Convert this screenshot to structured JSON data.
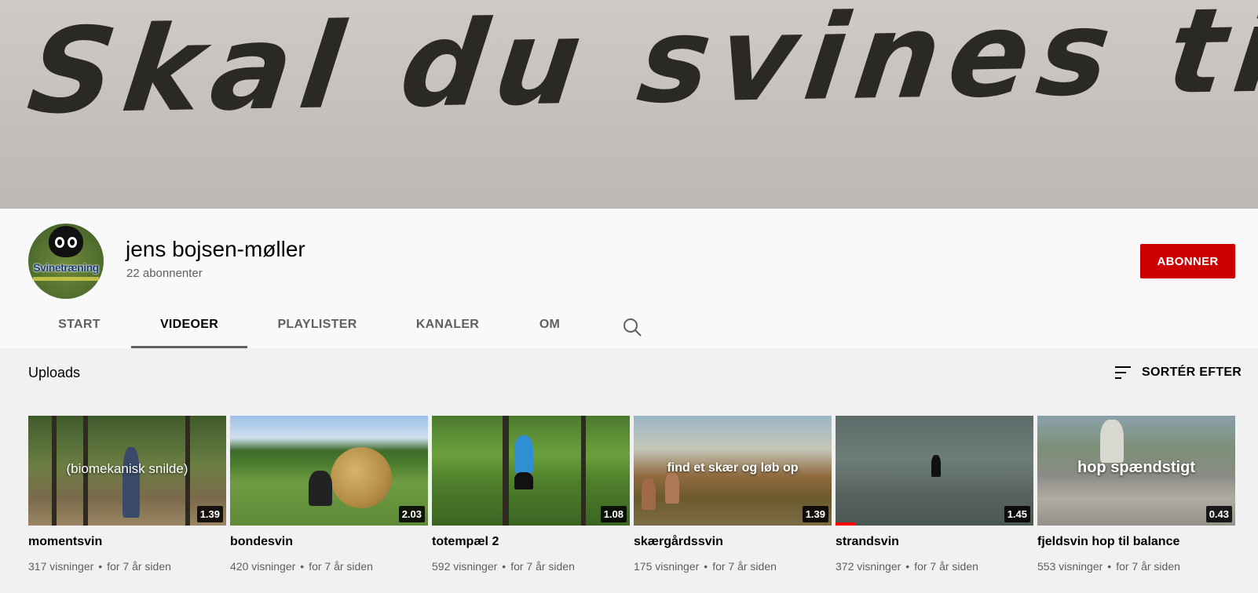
{
  "banner": {
    "text": "Skal du svines til!"
  },
  "channel": {
    "name": "jens bojsen-møller",
    "subscribers": "22 abonnenter",
    "avatar_text": "Svinetræning",
    "subscribe_label": "ABONNER"
  },
  "tabs": [
    {
      "label": "START"
    },
    {
      "label": "VIDEOER",
      "active": true
    },
    {
      "label": "PLAYLISTER"
    },
    {
      "label": "KANALER"
    },
    {
      "label": "OM"
    }
  ],
  "section": {
    "title": "Uploads",
    "sort_label": "SORTÉR EFTER",
    "sort_icon": "sort-icon"
  },
  "videos": [
    {
      "title": "momentsvin",
      "views": "317 visninger",
      "age": "for 7 år siden",
      "duration": "1.39",
      "overlay": "(biomekanisk snilde)"
    },
    {
      "title": "bondesvin",
      "views": "420 visninger",
      "age": "for 7 år siden",
      "duration": "2.03",
      "overlay": ""
    },
    {
      "title": "totempæl 2",
      "views": "592 visninger",
      "age": "for 7 år siden",
      "duration": "1.08",
      "overlay": ""
    },
    {
      "title": "skærgårdssvin",
      "views": "175 visninger",
      "age": "for 7 år siden",
      "duration": "1.39",
      "overlay": "find et skær og løb op"
    },
    {
      "title": "strandsvin",
      "views": "372 visninger",
      "age": "for 7 år siden",
      "duration": "1.45",
      "overlay": "",
      "watched_fraction": 0.1
    },
    {
      "title": "fjeldsvin hop til balance",
      "views": "553 visninger",
      "age": "for 7 år siden",
      "duration": "0.43",
      "overlay": "hop spændstigt"
    }
  ],
  "colors": {
    "brand_red": "#cc0000",
    "text_primary": "#030303",
    "text_secondary": "#606060"
  }
}
